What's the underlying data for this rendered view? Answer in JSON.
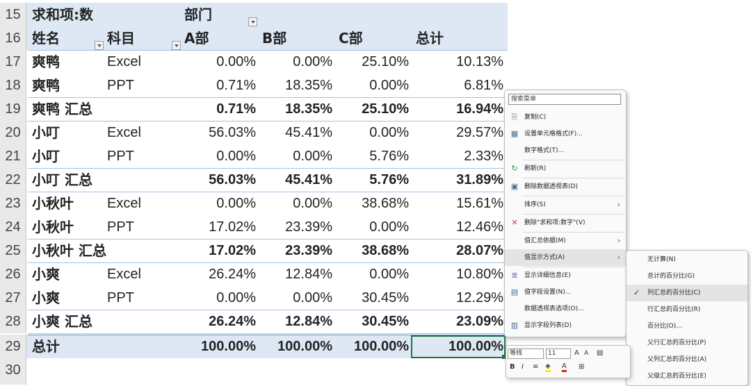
{
  "pivot": {
    "header1": {
      "row": "15",
      "value_label": "求和项:数",
      "dept_label": "部门"
    },
    "header2": {
      "row": "16",
      "name_label": "姓名",
      "subject_label": "科目",
      "cols": [
        "A部",
        "B部",
        "C部",
        "总计"
      ]
    },
    "rows": [
      {
        "row": "17",
        "name": "爽鸭",
        "subject": "Excel",
        "a": "0.00%",
        "b": "0.00%",
        "c": "25.10%",
        "total": "10.13%",
        "bold": false
      },
      {
        "row": "18",
        "name": "爽鸭",
        "subject": "PPT",
        "a": "0.71%",
        "b": "18.35%",
        "c": "0.00%",
        "total": "6.81%",
        "bold": false
      },
      {
        "row": "19",
        "name": "爽鸭 汇总",
        "subject": "",
        "a": "0.71%",
        "b": "18.35%",
        "c": "25.10%",
        "total": "16.94%",
        "bold": true
      },
      {
        "row": "20",
        "name": "小叮",
        "subject": "Excel",
        "a": "56.03%",
        "b": "45.41%",
        "c": "0.00%",
        "total": "29.57%",
        "bold": false
      },
      {
        "row": "21",
        "name": "小叮",
        "subject": "PPT",
        "a": "0.00%",
        "b": "0.00%",
        "c": "5.76%",
        "total": "2.33%",
        "bold": false
      },
      {
        "row": "22",
        "name": "小叮 汇总",
        "subject": "",
        "a": "56.03%",
        "b": "45.41%",
        "c": "5.76%",
        "total": "31.89%",
        "bold": true
      },
      {
        "row": "23",
        "name": "小秋叶",
        "subject": "Excel",
        "a": "0.00%",
        "b": "0.00%",
        "c": "38.68%",
        "total": "15.61%",
        "bold": false
      },
      {
        "row": "24",
        "name": "小秋叶",
        "subject": "PPT",
        "a": "17.02%",
        "b": "23.39%",
        "c": "0.00%",
        "total": "12.46%",
        "bold": false
      },
      {
        "row": "25",
        "name": "小秋叶 汇总",
        "subject": "",
        "a": "17.02%",
        "b": "23.39%",
        "c": "38.68%",
        "total": "28.07%",
        "bold": true
      },
      {
        "row": "26",
        "name": "小爽",
        "subject": "Excel",
        "a": "26.24%",
        "b": "12.84%",
        "c": "0.00%",
        "total": "10.80%",
        "bold": false
      },
      {
        "row": "27",
        "name": "小爽",
        "subject": "PPT",
        "a": "0.00%",
        "b": "0.00%",
        "c": "30.45%",
        "total": "12.29%",
        "bold": false
      },
      {
        "row": "28",
        "name": "小爽 汇总",
        "subject": "",
        "a": "26.24%",
        "b": "12.84%",
        "c": "30.45%",
        "total": "23.09%",
        "bold": true
      }
    ],
    "grand": {
      "row": "29",
      "name": "总计",
      "a": "100.00%",
      "b": "100.00%",
      "c": "100.00%",
      "total": "100.00%"
    },
    "empty_row": "30"
  },
  "context_menu": {
    "search_placeholder": "搜索菜单",
    "items": [
      {
        "label": "复制(C)",
        "icon": "copy-icon",
        "arrow": false
      },
      {
        "label": "设置单元格格式(F)...",
        "icon": "format-cells-icon",
        "arrow": false
      },
      {
        "label": "数字格式(T)...",
        "icon": "",
        "arrow": false
      },
      {
        "label": "刷新(R)",
        "icon": "refresh-icon",
        "arrow": false
      },
      {
        "label": "删除数据透视表(D)",
        "icon": "delete-pivot-icon",
        "arrow": false
      },
      {
        "label": "排序(S)",
        "icon": "",
        "arrow": true
      },
      {
        "label": "删除\"求和项:数字\"(V)",
        "icon": "remove-x-icon",
        "arrow": false
      },
      {
        "label": "值汇总依据(M)",
        "icon": "",
        "arrow": true
      },
      {
        "label": "值显示方式(A)",
        "icon": "",
        "arrow": true
      },
      {
        "label": "显示详细信息(E)",
        "icon": "show-details-icon",
        "arrow": false
      },
      {
        "label": "值字段设置(N)...",
        "icon": "field-settings-icon",
        "arrow": false
      },
      {
        "label": "数据透视表选项(O)...",
        "icon": "",
        "arrow": false
      },
      {
        "label": "显示字段列表(D)",
        "icon": "field-list-icon",
        "arrow": false
      }
    ]
  },
  "submenu": {
    "items": [
      {
        "label": "无计算(N)",
        "checked": false
      },
      {
        "label": "总计的百分比(G)",
        "checked": false
      },
      {
        "label": "列汇总的百分比(C)",
        "checked": true
      },
      {
        "label": "行汇总的百分比(R)",
        "checked": false
      },
      {
        "label": "百分比(O)...",
        "checked": false
      },
      {
        "label": "父行汇总的百分比(P)",
        "checked": false
      },
      {
        "label": "父列汇总的百分比(A)",
        "checked": false
      },
      {
        "label": "父级汇总的百分比(E)",
        "checked": false
      }
    ]
  },
  "mini_toolbar": {
    "font_name": "等线",
    "font_size": "11",
    "grow": "A",
    "shrink": "A",
    "bold": "B",
    "italic": "I",
    "align": "≡",
    "font_color": "A"
  },
  "colors": {
    "header_bg": "#dde8f4",
    "accent": "#217346",
    "rule": "#9fc3e6"
  }
}
